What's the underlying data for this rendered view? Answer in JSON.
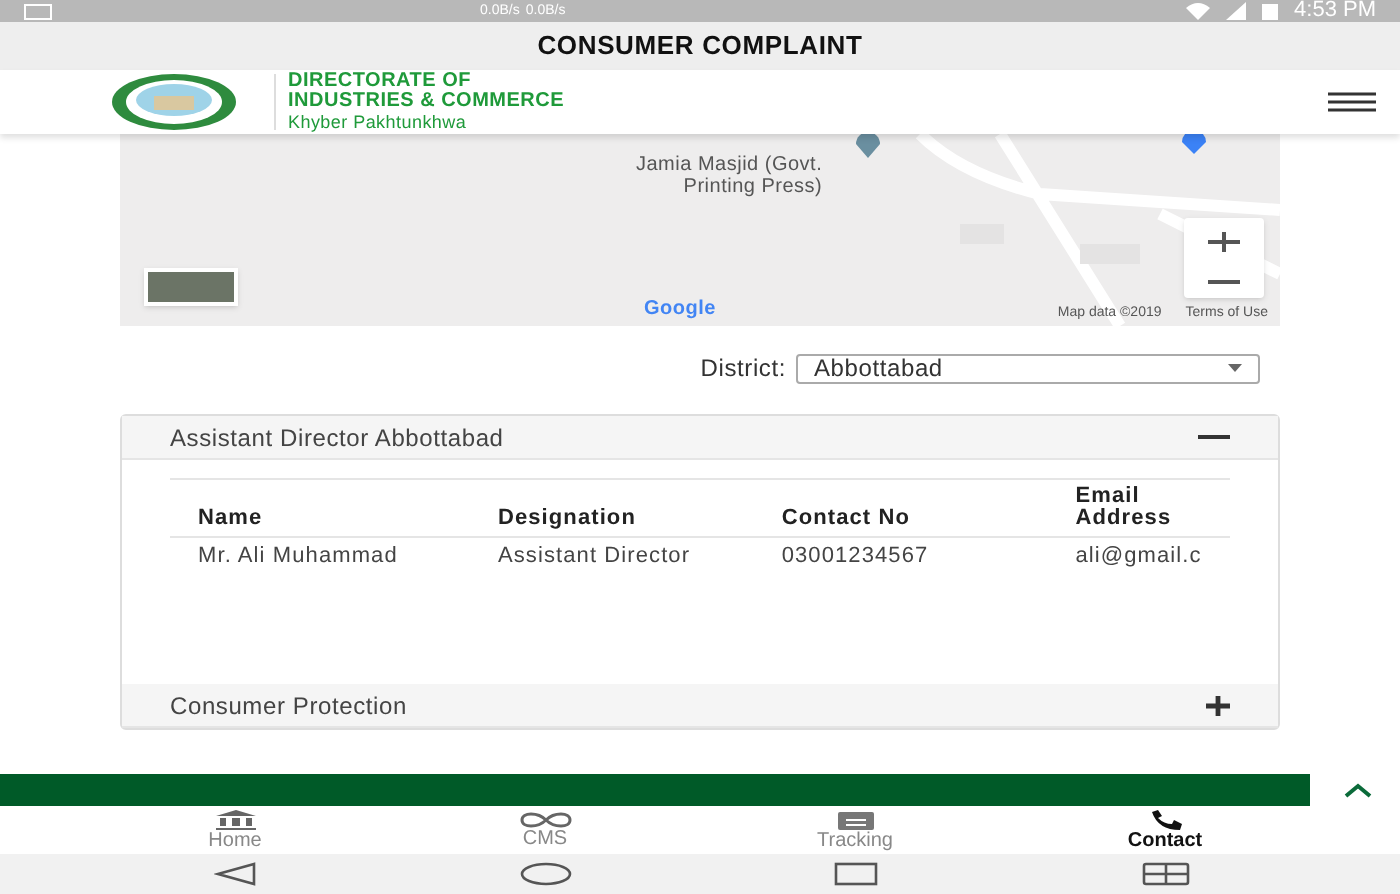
{
  "status_bar": {
    "network_speed": [
      "0.0B/s",
      "0.0B/s"
    ],
    "time": "4:53 PM"
  },
  "title_bar": {
    "title": "CONSUMER COMPLAINT"
  },
  "header": {
    "org_lines": [
      "DIRECTORATE OF",
      "INDUSTRIES & COMMERCE"
    ],
    "region": "Khyber Pakhtunkhwa"
  },
  "map": {
    "place_label": [
      "Jamia Masjid (Govt.",
      "Printing Press)"
    ],
    "brand": "Google",
    "map_data": "Map data ©2019",
    "terms": "Terms of Use"
  },
  "district": {
    "label": "District:",
    "value": "Abbottabad"
  },
  "panels": [
    {
      "title": "Assistant Director Abbottabad",
      "expanded": true,
      "table": {
        "columns": [
          "Name",
          "Designation",
          "Contact No",
          "Email Address"
        ],
        "rows": [
          [
            "Mr. Ali Muhammad",
            "Assistant Director",
            "03001234567",
            "ali@gmail.c"
          ]
        ]
      }
    },
    {
      "title": "Consumer Protection",
      "expanded": false
    }
  ],
  "bottom_nav": [
    {
      "label": "Home",
      "kind": "home",
      "selected": false
    },
    {
      "label": "CMS",
      "kind": "cms",
      "selected": false
    },
    {
      "label": "Tracking",
      "kind": "tracking",
      "selected": false
    },
    {
      "label": "Contact",
      "kind": "contact",
      "selected": true
    }
  ]
}
